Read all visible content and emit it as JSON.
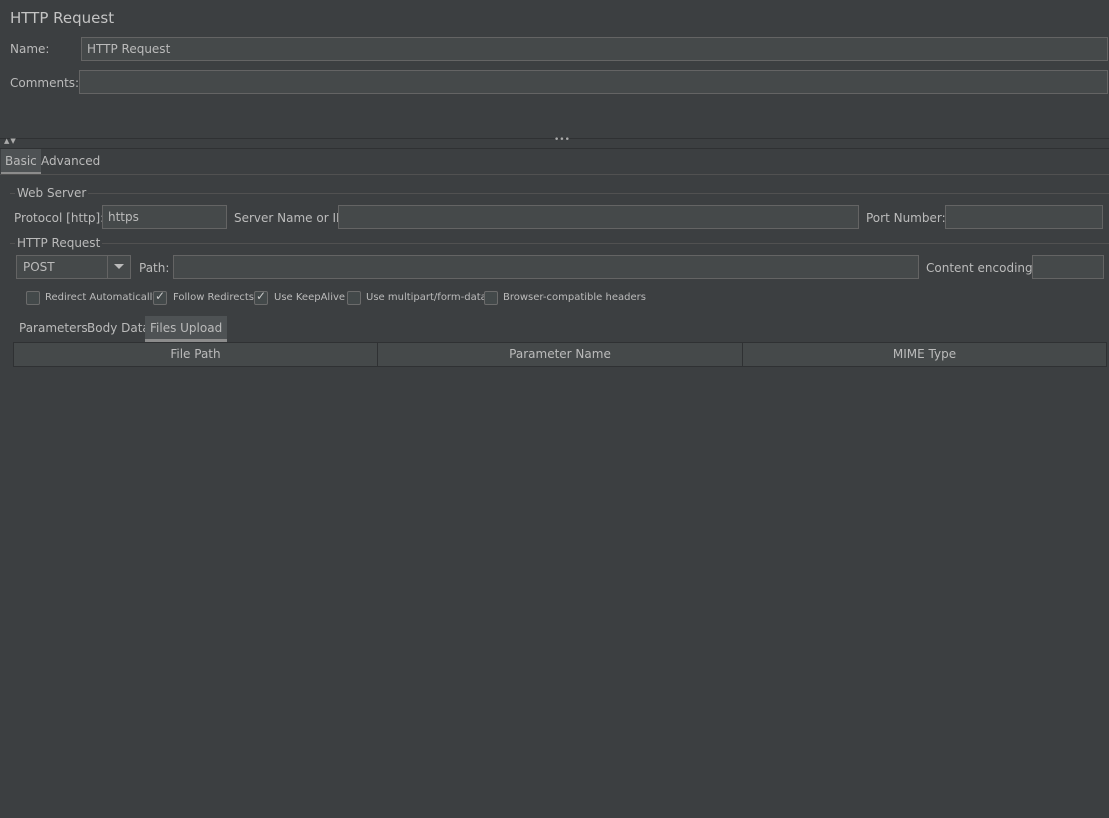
{
  "header": {
    "title": "HTTP Request"
  },
  "name_row": {
    "label": "Name:",
    "value": "HTTP Request"
  },
  "comments_row": {
    "label": "Comments:",
    "value": ""
  },
  "splitter": {
    "arrows": "▲▼",
    "grip": "•••"
  },
  "main_tabs": [
    {
      "label": "Basic",
      "active": true
    },
    {
      "label": "Advanced",
      "active": false
    }
  ],
  "web_server": {
    "title": "Web Server",
    "protocol_label": "Protocol [http]:",
    "protocol_value": "https",
    "server_label": "Server Name or IP:",
    "server_value": "",
    "port_label": "Port Number:",
    "port_value": ""
  },
  "http_request": {
    "title": "HTTP Request",
    "method": "POST",
    "path_label": "Path:",
    "path_value": "",
    "encoding_label": "Content encoding:",
    "encoding_value": ""
  },
  "options": [
    {
      "label": "Redirect Automatically",
      "checked": false
    },
    {
      "label": "Follow Redirects",
      "checked": true
    },
    {
      "label": "Use KeepAlive",
      "checked": true
    },
    {
      "label": "Use multipart/form-data",
      "checked": false
    },
    {
      "label": "Browser-compatible headers",
      "checked": false
    }
  ],
  "sub_tabs": [
    {
      "label": "Parameters",
      "active": false
    },
    {
      "label": "Body Data",
      "active": false
    },
    {
      "label": "Files Upload",
      "active": true
    }
  ],
  "files_table": {
    "columns": [
      "File Path",
      "Parameter Name",
      "MIME Type"
    ]
  },
  "colors": {
    "background": "#3c3f41",
    "field_background": "#45494a",
    "field_border": "#646464",
    "text": "#bbbbbb",
    "active_tab_underline": "#8c8c8c"
  }
}
